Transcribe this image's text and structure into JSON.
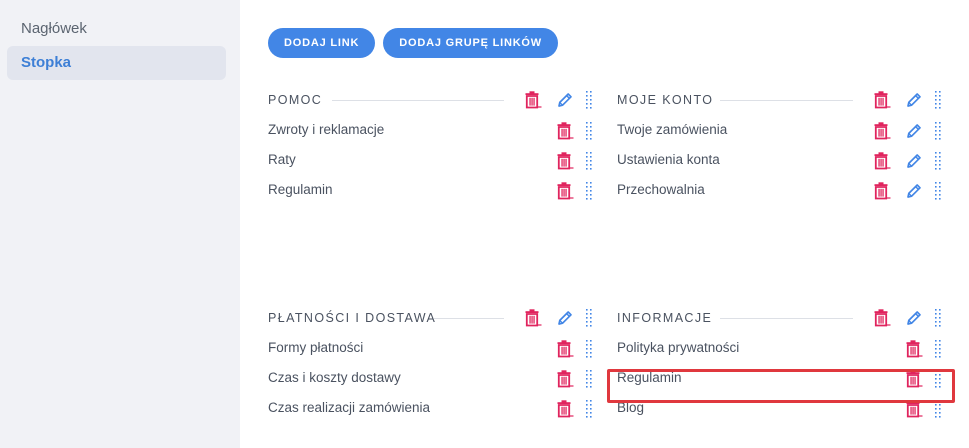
{
  "sidebar": {
    "items": [
      {
        "label": "Nagłówek"
      },
      {
        "label": "Stopka"
      }
    ]
  },
  "toolbar": {
    "add_link_label": "DODAJ LINK",
    "add_group_label": "DODAJ GRUPĘ LINKÓW"
  },
  "groups": [
    {
      "title": "POMOC",
      "items": [
        {
          "label": "Zwroty i reklamacje"
        },
        {
          "label": "Raty"
        },
        {
          "label": "Regulamin"
        }
      ]
    },
    {
      "title": "MOJE KONTO",
      "items": [
        {
          "label": "Twoje zamówienia"
        },
        {
          "label": "Ustawienia konta"
        },
        {
          "label": "Przechowalnia"
        }
      ]
    },
    {
      "title": "PŁATNOŚCI I DOSTAWA",
      "items": [
        {
          "label": "Formy płatności"
        },
        {
          "label": "Czas i koszty dostawy"
        },
        {
          "label": "Czas realizacji zamówienia"
        }
      ]
    },
    {
      "title": "INFORMACJE",
      "items": [
        {
          "label": "Polityka prywatności"
        },
        {
          "label": "Regulamin"
        },
        {
          "label": "Blog"
        }
      ]
    }
  ],
  "colors": {
    "accent": "#4286e6",
    "delete": "#e0245e",
    "highlight": "#e0383e"
  }
}
